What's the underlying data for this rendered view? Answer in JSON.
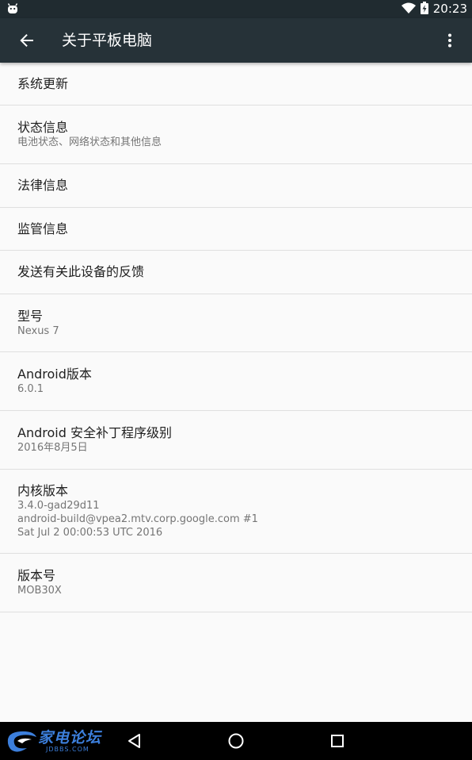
{
  "status_bar": {
    "time": "20:23",
    "icons": [
      "android-debug-icon",
      "wifi-icon",
      "battery-charging-icon"
    ]
  },
  "app_bar": {
    "title": "关于平板电脑",
    "back_icon": "arrow-back-icon",
    "overflow_icon": "more-vert-icon"
  },
  "items": [
    {
      "title": "系统更新",
      "summary": ""
    },
    {
      "title": "状态信息",
      "summary": "电池状态、网络状态和其他信息"
    },
    {
      "title": "法律信息",
      "summary": ""
    },
    {
      "title": "监管信息",
      "summary": ""
    },
    {
      "title": "发送有关此设备的反馈",
      "summary": ""
    },
    {
      "title": "型号",
      "summary": "Nexus 7"
    },
    {
      "title": "Android版本",
      "summary": "6.0.1"
    },
    {
      "title": "Android 安全补丁程序级别",
      "summary": "2016年8月5日"
    },
    {
      "title": "内核版本",
      "summary": "3.4.0-gad29d11",
      "summary2": "android-build@vpea2.mtv.corp.google.com #1",
      "summary3": "Sat Jul 2 00:00:53 UTC 2016"
    },
    {
      "title": "版本号",
      "summary": "MOB30X"
    }
  ],
  "nav_bar": {
    "buttons": [
      "back-triangle-icon",
      "home-circle-icon",
      "recents-square-icon"
    ]
  },
  "watermark": {
    "text": "家电论坛",
    "sub": "JDBBS.COM"
  },
  "colors": {
    "app_bar": "#263238",
    "status_bar": "#202b30",
    "background": "#fafafa",
    "divider": "#dfdfdf",
    "primary_text": "#212121",
    "secondary_text": "#757575"
  }
}
